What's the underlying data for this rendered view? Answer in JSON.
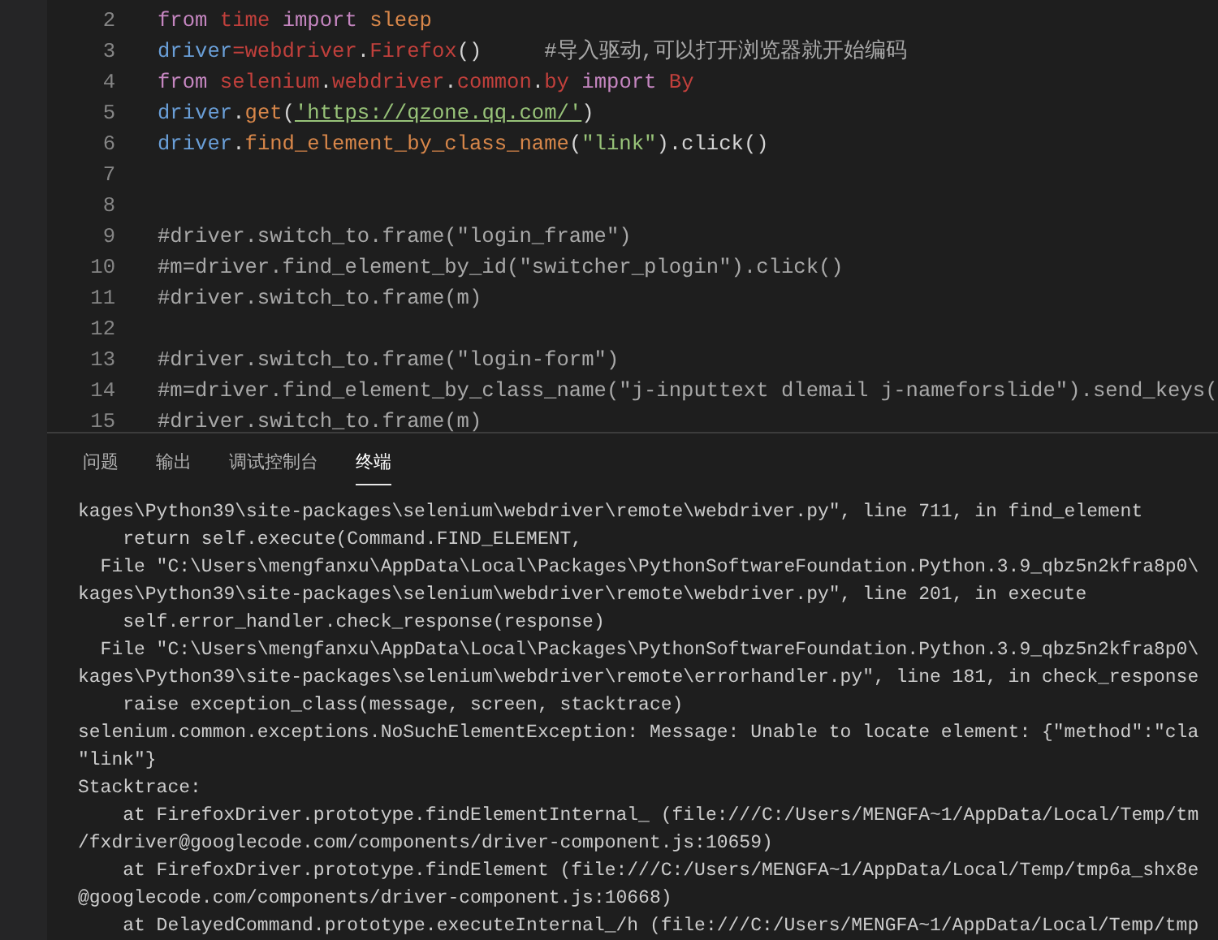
{
  "editor": {
    "lines": [
      {
        "number": "2",
        "tokens": [
          {
            "kind": "keyword",
            "text": "from "
          },
          {
            "kind": "module",
            "text": "time "
          },
          {
            "kind": "keyword",
            "text": "import "
          },
          {
            "kind": "func",
            "text": "sleep"
          }
        ]
      },
      {
        "number": "3",
        "tokens": [
          {
            "kind": "variable",
            "text": "driver"
          },
          {
            "kind": "module",
            "text": "=webdriver"
          },
          {
            "kind": "plain",
            "text": "."
          },
          {
            "kind": "module",
            "text": "Firefox"
          },
          {
            "kind": "plain",
            "text": "()     "
          },
          {
            "kind": "comment",
            "text": "#导入驱动,可以打开浏览器就开始编码"
          }
        ]
      },
      {
        "number": "4",
        "tokens": [
          {
            "kind": "keyword",
            "text": "from "
          },
          {
            "kind": "module",
            "text": "selenium"
          },
          {
            "kind": "plain",
            "text": "."
          },
          {
            "kind": "module",
            "text": "webdriver"
          },
          {
            "kind": "plain",
            "text": "."
          },
          {
            "kind": "module",
            "text": "common"
          },
          {
            "kind": "plain",
            "text": "."
          },
          {
            "kind": "module",
            "text": "by "
          },
          {
            "kind": "keyword",
            "text": "import "
          },
          {
            "kind": "module",
            "text": "By"
          }
        ]
      },
      {
        "number": "5",
        "tokens": [
          {
            "kind": "variable",
            "text": "driver"
          },
          {
            "kind": "plain",
            "text": "."
          },
          {
            "kind": "func",
            "text": "get"
          },
          {
            "kind": "plain",
            "text": "("
          },
          {
            "kind": "link",
            "text": "'https://qzone.qq.com/'"
          },
          {
            "kind": "plain",
            "text": ")"
          }
        ]
      },
      {
        "number": "6",
        "tokens": [
          {
            "kind": "variable",
            "text": "driver"
          },
          {
            "kind": "plain",
            "text": "."
          },
          {
            "kind": "func",
            "text": "find_element_by_class_name"
          },
          {
            "kind": "plain",
            "text": "("
          },
          {
            "kind": "string",
            "text": "\"link\""
          },
          {
            "kind": "plain",
            "text": ").click()"
          }
        ]
      },
      {
        "number": "7"
      },
      {
        "number": "8"
      },
      {
        "number": "9",
        "tokens": [
          {
            "kind": "comment",
            "text": "#driver.switch_to.frame(\"login_frame\")"
          }
        ]
      },
      {
        "number": "10",
        "tokens": [
          {
            "kind": "comment",
            "text": "#m=driver.find_element_by_id(\"switcher_plogin\").click()"
          }
        ]
      },
      {
        "number": "11",
        "tokens": [
          {
            "kind": "comment",
            "text": "#driver.switch_to.frame(m)"
          }
        ]
      },
      {
        "number": "12"
      },
      {
        "number": "13",
        "tokens": [
          {
            "kind": "comment",
            "text": "#driver.switch_to.frame(\"login-form\")"
          }
        ]
      },
      {
        "number": "14",
        "tokens": [
          {
            "kind": "comment",
            "text": "#m=driver.find_element_by_class_name(\"j-inputtext dlemail j-nameforslide\").send_keys("
          }
        ]
      },
      {
        "number": "15",
        "tokens": [
          {
            "kind": "comment",
            "text": "#driver.switch_to.frame(m)"
          }
        ]
      }
    ]
  },
  "panel": {
    "tabs": [
      {
        "label": "问题",
        "selected": false
      },
      {
        "label": "输出",
        "selected": false
      },
      {
        "label": "调试控制台",
        "selected": false
      },
      {
        "label": "终端",
        "selected": true
      }
    ],
    "terminal_lines": [
      "kages\\Python39\\site-packages\\selenium\\webdriver\\remote\\webdriver.py\", line 711, in find_element",
      "    return self.execute(Command.FIND_ELEMENT,",
      "  File \"C:\\Users\\mengfanxu\\AppData\\Local\\Packages\\PythonSoftwareFoundation.Python.3.9_qbz5n2kfra8p0\\",
      "kages\\Python39\\site-packages\\selenium\\webdriver\\remote\\webdriver.py\", line 201, in execute",
      "    self.error_handler.check_response(response)",
      "  File \"C:\\Users\\mengfanxu\\AppData\\Local\\Packages\\PythonSoftwareFoundation.Python.3.9_qbz5n2kfra8p0\\",
      "kages\\Python39\\site-packages\\selenium\\webdriver\\remote\\errorhandler.py\", line 181, in check_response",
      "    raise exception_class(message, screen, stacktrace)",
      "selenium.common.exceptions.NoSuchElementException: Message: Unable to locate element: {\"method\":\"cla",
      "\"link\"}",
      "Stacktrace:",
      "    at FirefoxDriver.prototype.findElementInternal_ (file:///C:/Users/MENGFA~1/AppData/Local/Temp/tm",
      "/fxdriver@googlecode.com/components/driver-component.js:10659)",
      "    at FirefoxDriver.prototype.findElement (file:///C:/Users/MENGFA~1/AppData/Local/Temp/tmp6a_shx8e",
      "@googlecode.com/components/driver-component.js:10668)",
      "    at DelayedCommand.prototype.executeInternal_/h (file:///C:/Users/MENGFA~1/AppData/Local/Temp/tmp"
    ]
  }
}
